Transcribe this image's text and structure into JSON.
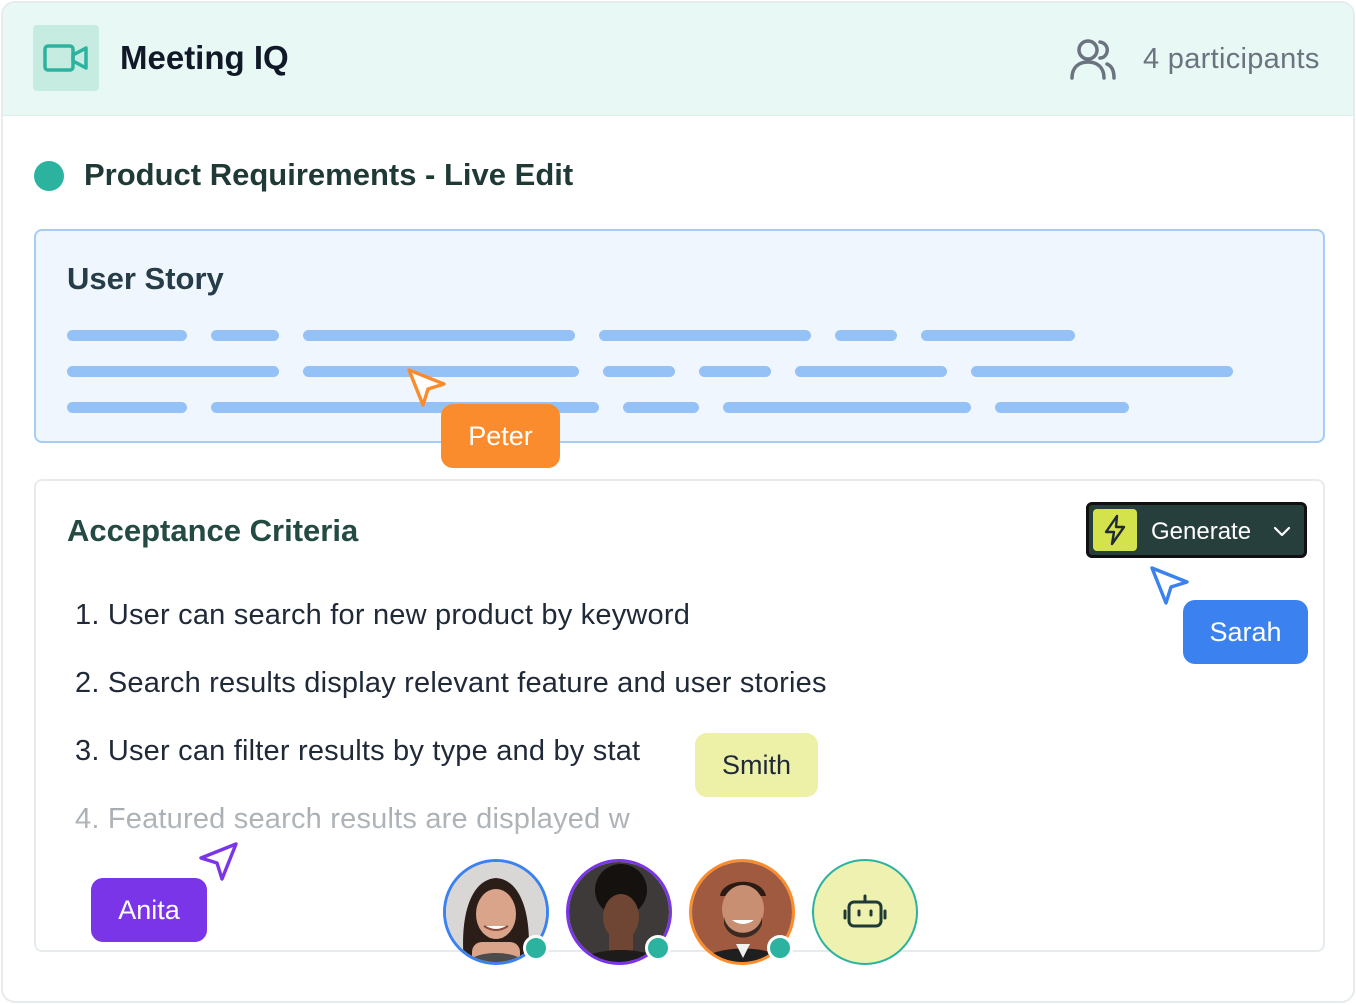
{
  "header": {
    "app_icon": "video-camera-icon",
    "app_title": "Meeting IQ",
    "participants_icon": "users-icon",
    "participants_label": "4 participants"
  },
  "document": {
    "title": "Product Requirements - Live Edit",
    "status_color": "#2bb3a0"
  },
  "user_story": {
    "title": "User Story"
  },
  "acceptance_criteria": {
    "title": "Acceptance Criteria",
    "generate_button": {
      "label": "Generate",
      "icon": "lightning-bolt-icon",
      "dropdown_icon": "chevron-down-icon"
    },
    "items": [
      "1. User can search for new product by keyword",
      "2. Search results display relevant feature and user stories",
      "3. User can filter results by type and by stat",
      "4. Featured search results are displayed w"
    ]
  },
  "collaborators": [
    {
      "name": "Peter",
      "color": "#fb8c2d"
    },
    {
      "name": "Sarah",
      "color": "#3b82f0"
    },
    {
      "name": "Smith",
      "color": "#edf0a7"
    },
    {
      "name": "Anita",
      "color": "#7b35e8"
    }
  ],
  "participants_bar": {
    "avatars": [
      "avatar-woman-smiling",
      "avatar-woman-serious",
      "avatar-man-smiling"
    ],
    "bot_icon": "robot-icon",
    "online_color": "#2bb3a0"
  },
  "colors": {
    "header_bg": "#e8f8f4",
    "story_bg": "#eff6fe",
    "story_line": "#94c2f6",
    "accent_teal": "#2bb3a0"
  }
}
